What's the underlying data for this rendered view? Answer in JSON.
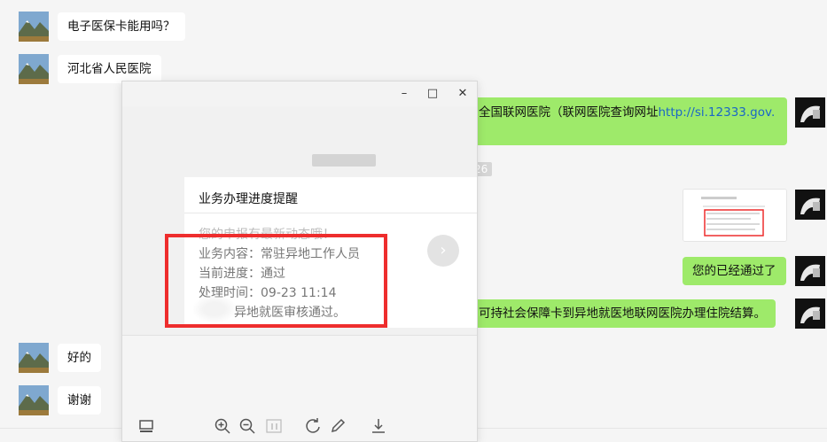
{
  "messages": {
    "m1": "电子医保卡能用吗？",
    "m2": "河北省人民医院",
    "m3_text": "全国联网医院（联网医院查询网址",
    "m3_link": "http://si.12333.gov.",
    "m5": "您的已经通过了",
    "m6": "可持社会保障卡到异地就医地联网医院办理住院结算。",
    "m7": "好的",
    "m8": "谢谢"
  },
  "faint_timestamp": "26",
  "viewer": {
    "card": {
      "title": "业务办理进度提醒",
      "line1": "您的申报有最新动态哦！",
      "line2": "业务内容：常驻异地工作人员",
      "line3": "当前进度：通过",
      "line4": "处理时间：09-23 11:14",
      "line5": "异地就医审核通过。"
    },
    "window_buttons": {
      "minimize": "–",
      "maximize": "□",
      "close": "✕"
    }
  },
  "colors": {
    "sent_bubble": "#9eea6a",
    "received_bubble": "#ffffff",
    "highlight_box": "#ee2d2d",
    "link": "#1a66c7"
  }
}
